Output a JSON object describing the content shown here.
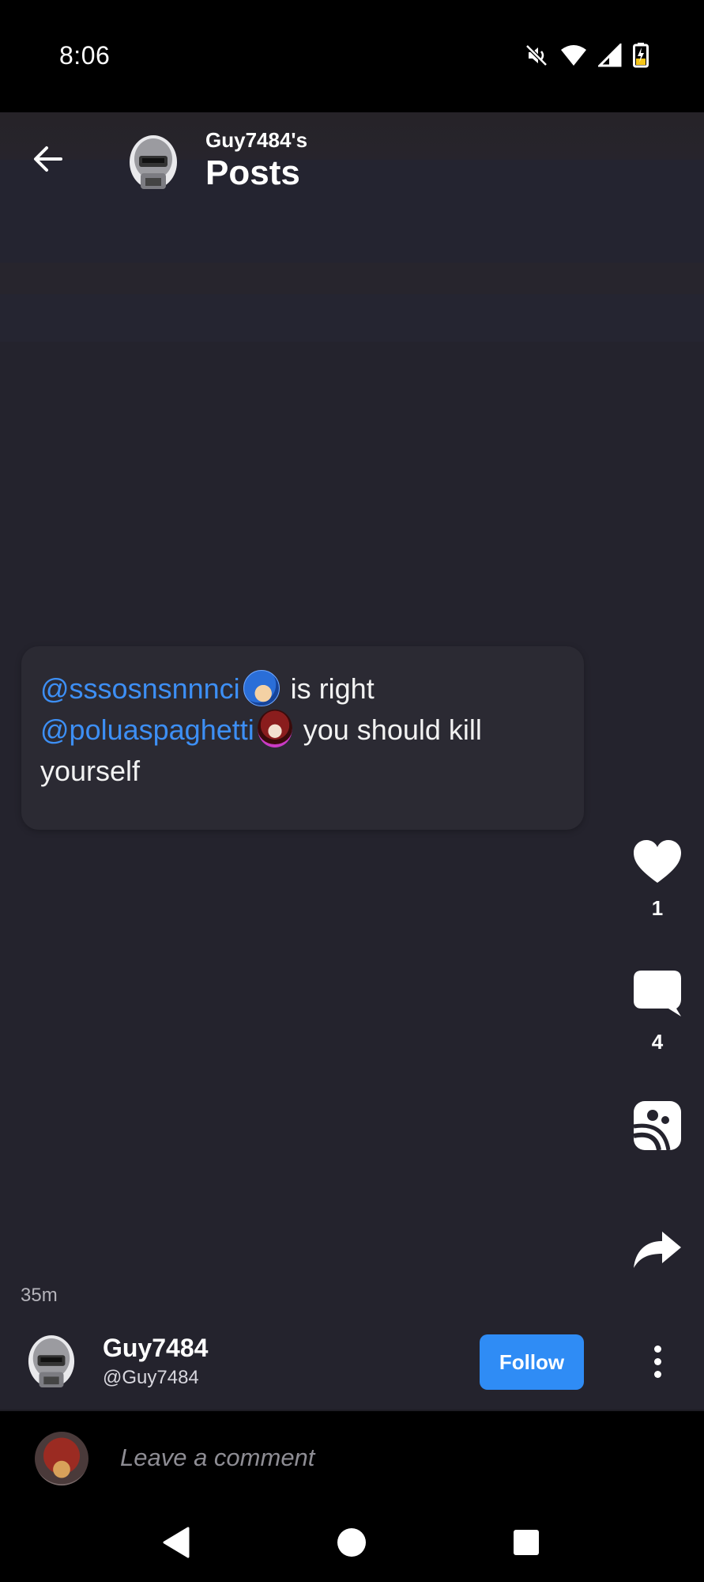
{
  "status_bar": {
    "time": "8:06",
    "icons": [
      "mute-icon",
      "wifi-icon",
      "signal-icon",
      "battery-charging-icon"
    ]
  },
  "header": {
    "subtitle": "Guy7484's",
    "title": "Posts"
  },
  "post": {
    "mention_1": "@sssosnsnnnci",
    "text_1": " is right",
    "mention_2": "@poluaspaghetti",
    "text_2": " you should kill yourself",
    "timestamp": "35m"
  },
  "actions": {
    "like_count": "1",
    "comment_count": "4",
    "icons": [
      "heart-icon",
      "comment-icon",
      "duet-icon",
      "share-icon"
    ]
  },
  "author": {
    "name": "Guy7484",
    "handle": "@Guy7484",
    "follow_label": "Follow"
  },
  "comment": {
    "placeholder": "Leave a comment"
  },
  "colors": {
    "background": "#24232d",
    "card": "#2b2a33",
    "mention": "#3d8ff5",
    "follow_button": "#2f8cf5"
  }
}
